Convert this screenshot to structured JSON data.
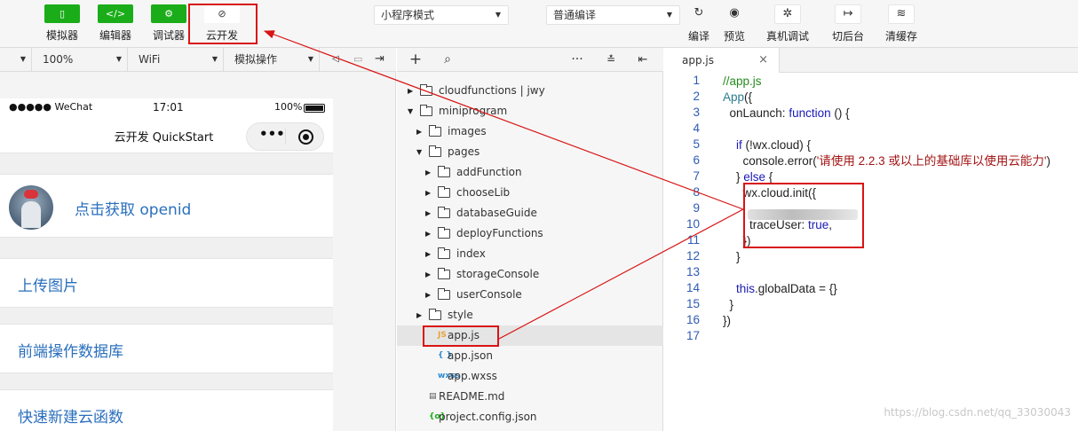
{
  "toolbar": {
    "left_buttons": [
      {
        "label": "模拟器",
        "icon": "phone-icon",
        "glyph": "▯"
      },
      {
        "label": "编辑器",
        "icon": "code-icon",
        "glyph": "</>"
      },
      {
        "label": "调试器",
        "icon": "debugger-icon",
        "glyph": "⚙"
      },
      {
        "label": "云开发",
        "icon": "cloud-link-icon",
        "glyph": "⊘"
      }
    ],
    "mode_select": "小程序模式",
    "compile_select": "普通编译",
    "right_buttons": [
      {
        "label": "编译",
        "icon": "refresh-icon",
        "glyph": "↻"
      },
      {
        "label": "预览",
        "icon": "eye-icon",
        "glyph": "◉"
      },
      {
        "label": "真机调试",
        "icon": "bug-icon",
        "glyph": "✲"
      },
      {
        "label": "切后台",
        "icon": "switch-background-icon",
        "glyph": "↦"
      },
      {
        "label": "清缓存",
        "icon": "layers-icon",
        "glyph": "≋"
      }
    ]
  },
  "simulator_bar": {
    "device_select": "",
    "zoom": "100%",
    "network": "WiFi",
    "operation": "模拟操作"
  },
  "phone": {
    "status_left": "●●●●● WeChat",
    "status_time": "17:01",
    "status_battery": "100%",
    "nav_title": "云开发 QuickStart",
    "capsule_dots": "•••",
    "openid_button": "点击获取 openid",
    "menu_items": [
      "上传图片",
      "前端操作数据库",
      "快速新建云函数"
    ]
  },
  "file_tree": {
    "nodes": [
      {
        "name": "cloudfunctions | jwy",
        "depth": 0,
        "type": "folder",
        "arrow": "▶"
      },
      {
        "name": "miniprogram",
        "depth": 0,
        "type": "folder",
        "arrow": "▼"
      },
      {
        "name": "images",
        "depth": 1,
        "type": "folder",
        "arrow": "▶"
      },
      {
        "name": "pages",
        "depth": 1,
        "type": "folder",
        "arrow": "▼"
      },
      {
        "name": "addFunction",
        "depth": 2,
        "type": "folder",
        "arrow": "▶"
      },
      {
        "name": "chooseLib",
        "depth": 2,
        "type": "folder",
        "arrow": "▶"
      },
      {
        "name": "databaseGuide",
        "depth": 2,
        "type": "folder",
        "arrow": "▶"
      },
      {
        "name": "deployFunctions",
        "depth": 2,
        "type": "folder",
        "arrow": "▶"
      },
      {
        "name": "index",
        "depth": 2,
        "type": "folder",
        "arrow": "▶"
      },
      {
        "name": "storageConsole",
        "depth": 2,
        "type": "folder",
        "arrow": "▶"
      },
      {
        "name": "userConsole",
        "depth": 2,
        "type": "folder",
        "arrow": "▶"
      },
      {
        "name": "style",
        "depth": 1,
        "type": "folder",
        "arrow": "▶"
      },
      {
        "name": "app.js",
        "depth": 1,
        "type": "file",
        "badge": "JS",
        "badge_color": "#e8a33a"
      },
      {
        "name": "app.json",
        "depth": 1,
        "type": "file",
        "badge": "{ }",
        "badge_color": "#2a8ad4"
      },
      {
        "name": "app.wxss",
        "depth": 1,
        "type": "file",
        "badge": "wxss",
        "badge_color": "#2a8ad4"
      },
      {
        "name": "README.md",
        "depth": 0,
        "type": "file",
        "badge": "▤",
        "badge_color": "#555555"
      },
      {
        "name": "project.config.json",
        "depth": 0,
        "type": "file",
        "badge": "{o}",
        "badge_color": "#1aad19"
      }
    ]
  },
  "editor": {
    "tab": "app.js",
    "tab_close": "×",
    "lines": [
      [
        [
          "cm",
          "//app.js"
        ]
      ],
      [
        [
          "fn",
          "App"
        ],
        [
          "",
          "({"
        ]
      ],
      [
        [
          "",
          "  onLaunch: "
        ],
        [
          "kw",
          "function"
        ],
        [
          "",
          " () {"
        ]
      ],
      [
        [
          "",
          ""
        ]
      ],
      [
        [
          "",
          "    "
        ],
        [
          "kw",
          "if"
        ],
        [
          "",
          " (!wx.cloud) {"
        ]
      ],
      [
        [
          "",
          "      console.error("
        ],
        [
          "st",
          "'请使用 2.2.3 或以上的基础库以使用云能力'"
        ],
        [
          "",
          ")"
        ]
      ],
      [
        [
          "",
          "    } "
        ],
        [
          "kw",
          "else"
        ],
        [
          "",
          " {"
        ]
      ],
      [
        [
          "",
          "      wx.cloud.init({"
        ]
      ],
      [
        [
          "",
          "        "
        ]
      ],
      [
        [
          "",
          "        traceUser: "
        ],
        [
          "kw",
          "true"
        ],
        [
          "",
          ","
        ]
      ],
      [
        [
          "",
          "      })"
        ]
      ],
      [
        [
          "",
          "    }"
        ]
      ],
      [
        [
          "",
          ""
        ]
      ],
      [
        [
          "",
          "    "
        ],
        [
          "kw",
          "this"
        ],
        [
          "",
          ".globalData = {}"
        ]
      ],
      [
        [
          "",
          "  }"
        ]
      ],
      [
        [
          "",
          "})"
        ]
      ],
      [
        [
          "",
          ""
        ]
      ]
    ]
  },
  "watermark": "https://blog.csdn.net/qq_33030043",
  "colors": {
    "accent_green": "#1aad19",
    "link_blue": "#2a6fbd",
    "highlight_red": "#d81414"
  }
}
